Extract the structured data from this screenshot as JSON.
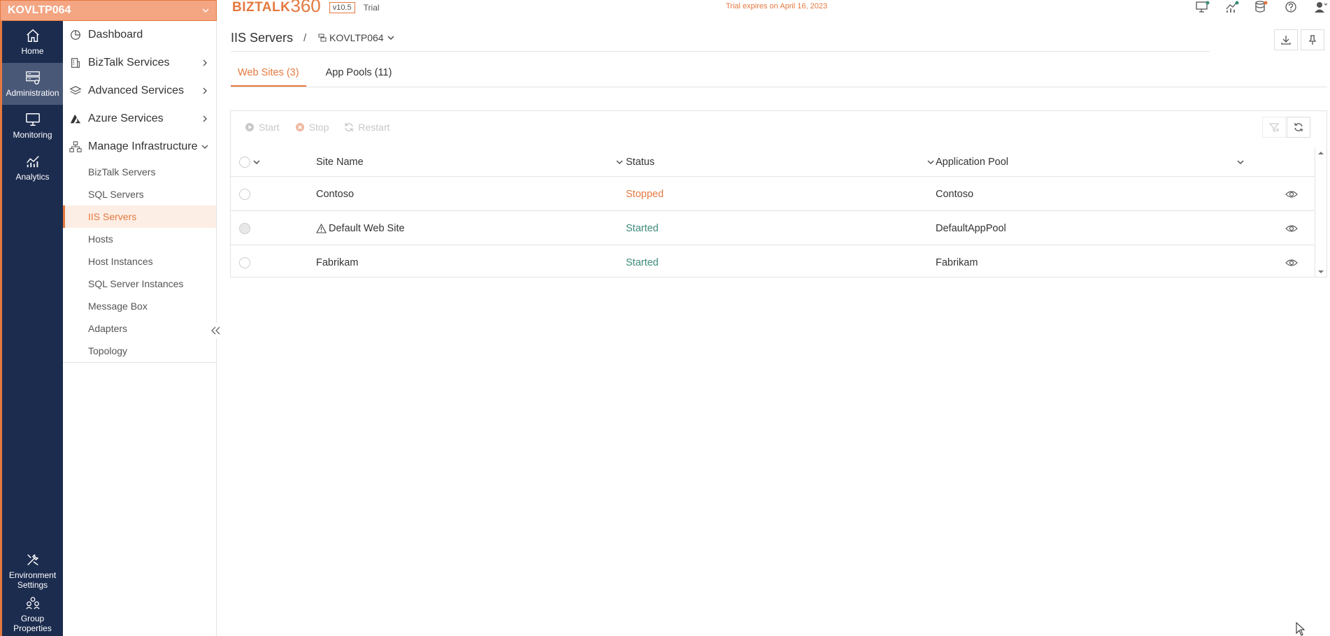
{
  "environment": {
    "name": "KOVLTP064"
  },
  "rail": {
    "top": [
      {
        "label": "Home",
        "icon": "home-icon"
      },
      {
        "label": "Administration",
        "icon": "server-admin-icon",
        "active": true
      },
      {
        "label": "Monitoring",
        "icon": "monitor-icon"
      },
      {
        "label": "Analytics",
        "icon": "analytics-chart-icon"
      }
    ],
    "bottom": [
      {
        "label": "Environment Settings",
        "icon": "tools-icon"
      },
      {
        "label": "Group Properties",
        "icon": "group-icon"
      }
    ]
  },
  "nav": {
    "items": [
      {
        "label": "Dashboard",
        "icon": "dashboard-pie-icon",
        "arrow": ""
      },
      {
        "label": "BizTalk Services",
        "icon": "building-icon",
        "arrow": "right"
      },
      {
        "label": "Advanced Services",
        "icon": "layers-icon",
        "arrow": "right"
      },
      {
        "label": "Azure Services",
        "icon": "azure-icon",
        "arrow": "right"
      },
      {
        "label": "Manage Infrastructure",
        "icon": "network-icon",
        "arrow": "down"
      }
    ],
    "sub_items": [
      "BizTalk Servers",
      "SQL Servers",
      "IIS Servers",
      "Hosts",
      "Host Instances",
      "SQL Server Instances",
      "Message Box",
      "Adapters",
      "Topology"
    ],
    "active_sub": "IIS Servers"
  },
  "header": {
    "brand_text": "BIZTALK",
    "brand_num": "360",
    "version": "v10.5",
    "trial": "Trial",
    "trial_expiry": "Trial expires on April 16, 2023"
  },
  "page": {
    "title": "IIS Servers",
    "separator": "/",
    "server": "KOVLTP064"
  },
  "tabs": [
    {
      "label": "Web Sites (3)",
      "active": true
    },
    {
      "label": "App Pools (11)",
      "active": false
    }
  ],
  "toolbar": {
    "start": "Start",
    "stop": "Stop",
    "restart": "Restart"
  },
  "table": {
    "columns": [
      "Site Name",
      "Status",
      "Application Pool"
    ],
    "rows": [
      {
        "site": "Contoso",
        "status": "Stopped",
        "pool": "Contoso",
        "warning": false
      },
      {
        "site": "Default Web Site",
        "status": "Started",
        "pool": "DefaultAppPool",
        "warning": true
      },
      {
        "site": "Fabrikam",
        "status": "Started",
        "pool": "Fabrikam",
        "warning": false
      }
    ]
  },
  "colors": {
    "accent": "#e4793f",
    "rail_bg": "#1c2c4f",
    "status_started": "#3d8b7a",
    "status_stopped": "#e4793f"
  }
}
